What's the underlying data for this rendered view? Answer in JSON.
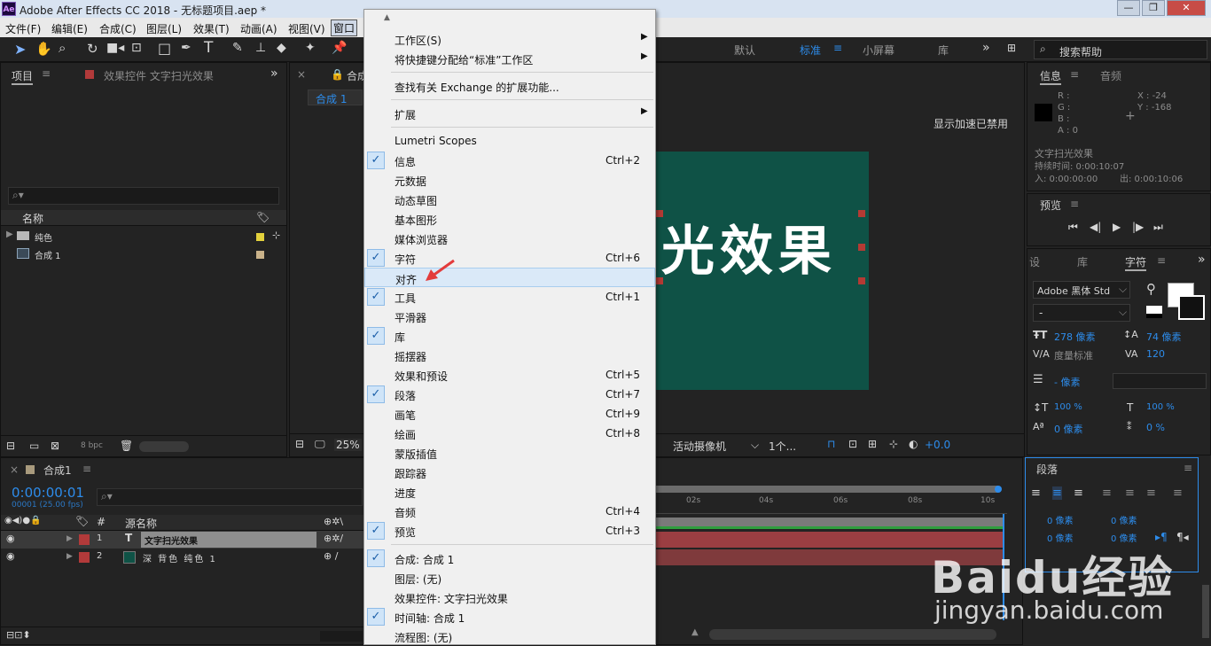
{
  "window": {
    "title": "Adobe After Effects CC 2018 - 无标题项目.aep *",
    "logo": "Ae",
    "buttons": [
      "—",
      "❐",
      "✕"
    ]
  },
  "menubar": [
    "文件(F)",
    "编辑(E)",
    "合成(C)",
    "图层(L)",
    "效果(T)",
    "动画(A)",
    "视图(V)",
    "窗口"
  ],
  "toolbar": {
    "workspaces": [
      "默认",
      "标准",
      "小屏幕",
      "库"
    ],
    "active_workspace": "标准",
    "search_placeholder": "搜索帮助"
  },
  "project_panel": {
    "tab_project": "项目",
    "tab_effects": "效果控件 文字扫光效果",
    "col_name": "名称",
    "items": [
      {
        "name": "纯色",
        "type": "folder"
      },
      {
        "name": "合成 1",
        "type": "comp"
      }
    ],
    "bpc": "8 bpc"
  },
  "comp_panel": {
    "tab": "合成",
    "subtab": "合成 1",
    "accel_disabled": "显示加速已禁用",
    "zoom": "25%",
    "camera": "活动摄像机",
    "views": "1个...",
    "exposure": "+0.0",
    "preview_text": "光效果"
  },
  "info_panel": {
    "tab_info": "信息",
    "tab_audio": "音频",
    "r": "R :",
    "g": "G :",
    "b": "B :",
    "a": "A : 0",
    "x": "X : -24",
    "y": "Y : -168",
    "layer_name": "文字扫光效果",
    "duration": "持续时间: 0:00:10:07",
    "in_point": "入: 0:00:00:00",
    "out_point": "出: 0:00:10:06"
  },
  "preview_panel": {
    "title": "预览"
  },
  "character_panel": {
    "tabs": [
      "设",
      "库",
      "字符"
    ],
    "font": "Adobe 黑体 Std",
    "style": "-",
    "size": "278 像素",
    "leading": "74 像素",
    "kerning": "度量标准",
    "tracking": "120",
    "stroke": "- 像素",
    "vscale": "100 %",
    "hscale": "100 %",
    "baseline": "0 像素",
    "tsume": "0 %"
  },
  "paragraph_panel": {
    "title": "段落",
    "indent": "0 像素",
    "space": "0 像素"
  },
  "timeline": {
    "tab": "合成1",
    "timecode": "0:00:00:01",
    "fps": "00001 (25.00 fps)",
    "col_num": "#",
    "col_source": "源名称",
    "ruler": [
      "02s",
      "04s",
      "06s",
      "08s",
      "10s"
    ],
    "layers": [
      {
        "num": "1",
        "name": "文字扫光效果",
        "type": "T",
        "color": "#b23a3a"
      },
      {
        "num": "2",
        "name": "深 背色 纯色 1",
        "type": "solid",
        "color": "#b23a3a"
      }
    ]
  },
  "window_menu": {
    "items": [
      {
        "label": "工作区(S)",
        "submenu": true
      },
      {
        "label": "将快捷键分配给“标准”工作区",
        "submenu": true
      },
      {
        "sep": true
      },
      {
        "label": "查找有关 Exchange 的扩展功能..."
      },
      {
        "sep": true
      },
      {
        "label": "扩展",
        "submenu": true
      },
      {
        "sep": true
      },
      {
        "label": "Lumetri Scopes"
      },
      {
        "label": "信息",
        "checked": true,
        "shortcut": "Ctrl+2"
      },
      {
        "label": "元数据"
      },
      {
        "label": "动态草图"
      },
      {
        "label": "基本图形"
      },
      {
        "label": "媒体浏览器"
      },
      {
        "label": "字符",
        "checked": true,
        "shortcut": "Ctrl+6"
      },
      {
        "label": "对齐",
        "highlighted": true
      },
      {
        "label": "工具",
        "checked": true,
        "shortcut": "Ctrl+1"
      },
      {
        "label": "平滑器"
      },
      {
        "label": "库",
        "checked": true
      },
      {
        "label": "摇摆器"
      },
      {
        "label": "效果和预设",
        "shortcut": "Ctrl+5"
      },
      {
        "label": "段落",
        "checked": true,
        "shortcut": "Ctrl+7"
      },
      {
        "label": "画笔",
        "shortcut": "Ctrl+9"
      },
      {
        "label": "绘画",
        "shortcut": "Ctrl+8"
      },
      {
        "label": "蒙版插值"
      },
      {
        "label": "跟踪器"
      },
      {
        "label": "进度"
      },
      {
        "label": "音频",
        "shortcut": "Ctrl+4"
      },
      {
        "label": "预览",
        "checked": true,
        "shortcut": "Ctrl+3"
      },
      {
        "sep": true
      },
      {
        "label": "合成: 合成 1",
        "checked": true
      },
      {
        "label": "图层: (无)"
      },
      {
        "label": "效果控件: 文字扫光效果"
      },
      {
        "label": "时间轴: 合成 1",
        "checked": true
      },
      {
        "label": "流程图: (无)"
      }
    ]
  },
  "watermark": {
    "brand": "Baidu经验",
    "url": "jingyan.baidu.com"
  }
}
